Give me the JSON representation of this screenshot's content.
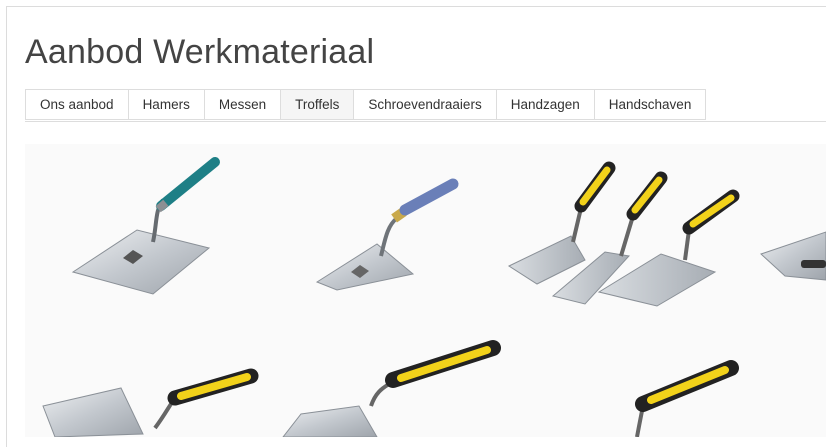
{
  "page": {
    "title": "Aanbod Werkmateriaal"
  },
  "tabs": [
    {
      "label": "Ons aanbod"
    },
    {
      "label": "Hamers"
    },
    {
      "label": "Messen"
    },
    {
      "label": "Troffels",
      "active": true
    },
    {
      "label": "Schroevendraaiers"
    },
    {
      "label": "Handzagen"
    },
    {
      "label": "Handschaven"
    }
  ],
  "gallery": {
    "items": [
      {
        "icon": "trowel-teal-handle-icon"
      },
      {
        "icon": "trowel-blue-handle-icon"
      },
      {
        "icon": "three-trowels-yellow-handle-icon"
      },
      {
        "icon": "float-trowel-icon"
      },
      {
        "icon": "trowel-yellow-handle-icon"
      },
      {
        "icon": "trowel-yellow-handle-icon"
      },
      {
        "icon": "trowel-yellow-handle-icon"
      }
    ]
  },
  "colors": {
    "title": "#444444",
    "tab_border": "#dddddd",
    "active_tab_bg": "#f5f5f5",
    "handle_yellow": "#f2d21a",
    "handle_teal": "#1e7f86",
    "handle_blue": "#6a7fb8",
    "steel": "#c9cdd2"
  }
}
